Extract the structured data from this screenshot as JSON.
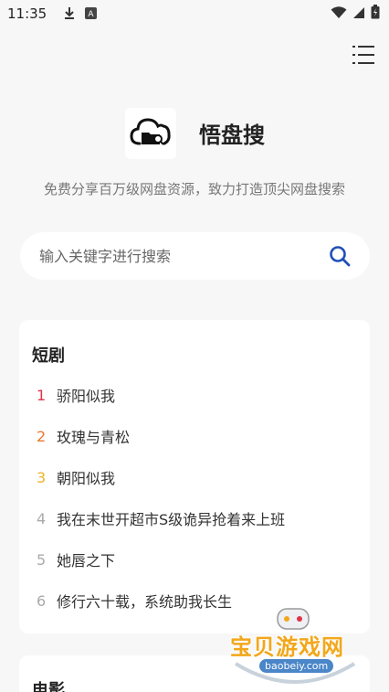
{
  "status_bar": {
    "time": "11:35",
    "icons": [
      "download-icon",
      "notification-a-icon",
      "wifi-icon",
      "signal-icon",
      "battery-icon"
    ]
  },
  "header": {
    "menu_icon": "menu-icon",
    "app_name": "悟盘搜",
    "tagline": "免费分享百万级网盘资源，致力打造顶尖网盘搜索",
    "logo_icon": "cloud-folder-search-icon"
  },
  "search": {
    "placeholder": "输入关键字进行搜索",
    "value": "",
    "icon": "search-icon"
  },
  "sections": [
    {
      "title": "短剧",
      "items": [
        {
          "rank": "1",
          "text": "骄阳似我"
        },
        {
          "rank": "2",
          "text": "玫瑰与青松"
        },
        {
          "rank": "3",
          "text": "朝阳似我"
        },
        {
          "rank": "4",
          "text": "我在末世开超市S级诡异抢着来上班"
        },
        {
          "rank": "5",
          "text": "她唇之下"
        },
        {
          "rank": "6",
          "text": "修行六十载，系统助我长生"
        }
      ]
    },
    {
      "title": "电影",
      "items": []
    }
  ],
  "rank_colors": {
    "1": "#e0334a",
    "2": "#e8772e",
    "3": "#f0b429",
    "default": "#aaaaaa"
  },
  "watermark": {
    "text": "宝贝游戏网",
    "url": "baobeiy.com"
  }
}
